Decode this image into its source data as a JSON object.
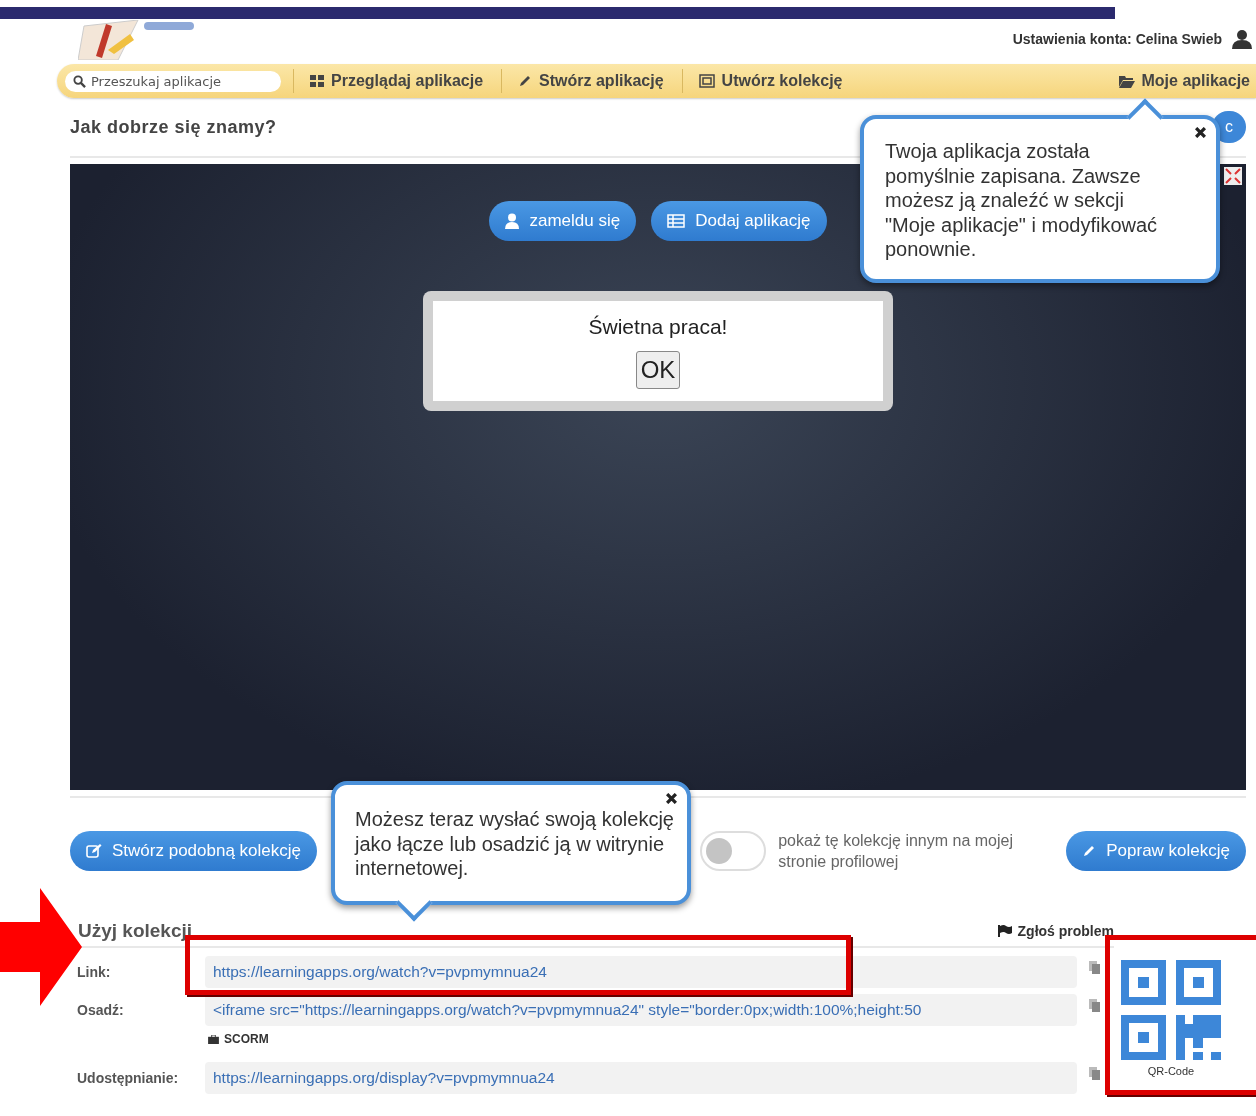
{
  "header": {
    "account_label": "Ustawienia konta: Celina Swieb"
  },
  "nav": {
    "search": {
      "placeholder": "Przeszukaj aplikacje"
    },
    "items": [
      {
        "label": "Przeglądaj aplikacje"
      },
      {
        "label": "Stwórz aplikację"
      },
      {
        "label": "Utwórz kolekcję"
      }
    ],
    "my_apps": {
      "label": "Moje aplikacje"
    }
  },
  "title": "Jak dobrze się znamy?",
  "corner_button": "c",
  "player": {
    "buttons": [
      {
        "label": "zameldu się"
      },
      {
        "label": "Dodaj aplikację"
      }
    ],
    "dialog": {
      "message": "Świetna praca!",
      "button": "OK"
    }
  },
  "tooltips": [
    {
      "kind": "top",
      "text": "Twoja aplikacja została pomyślnie zapisana. Zawsze możesz ją znaleźć w sekcji \"Moje aplikacje\" i modyfikować ponownie."
    },
    {
      "kind": "bottom",
      "text": "Możesz teraz wysłać swoją kolekcję jako łącze lub osadzić ją w witrynie internetowej."
    }
  ],
  "actions": {
    "similar_button": "Stwórz podobną kolekcję",
    "toggle": {
      "on": false,
      "label": "pokaż tę kolekcję innym na mojej stronie profilowej"
    },
    "edit_button": "Popraw kolekcję"
  },
  "use": {
    "heading": "Użyj kolekcji",
    "report": "Zgłoś problem",
    "rows": [
      {
        "label": "Link:",
        "value": "https://learningapps.org/watch?v=pvpmymnua24"
      },
      {
        "label": "Osadź:",
        "value": "<iframe src=\"https://learningapps.org/watch?v=pvpmymnua24\" style=\"border:0px;width:100%;height:50",
        "extra": "SCORM"
      },
      {
        "label": "Udostępnianie:",
        "value": "https://learningapps.org/display?v=pvpmymnua24"
      }
    ],
    "qr_label": "QR-Code"
  }
}
